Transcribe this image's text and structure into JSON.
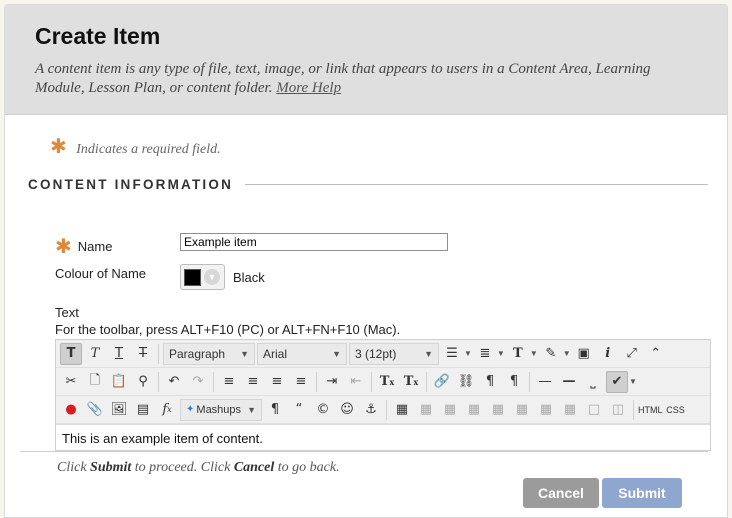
{
  "header": {
    "title": "Create Item",
    "description": "A content item is any type of file, text, image, or link that appears to users in a Content Area, Learning Module, Lesson Plan, or content folder.",
    "help_link": "More Help"
  },
  "required_note": "Indicates a required field.",
  "section": {
    "title": "CONTENT INFORMATION"
  },
  "fields": {
    "name_label": "Name",
    "name_value": "Example item",
    "colour_label": "Colour of Name",
    "colour_value": "Black",
    "colour_hex": "#000000",
    "text_label": "Text",
    "toolbar_hint": "For the toolbar, press ALT+F10 (PC) or ALT+FN+F10 (Mac)."
  },
  "editor": {
    "paragraph_select": "Paragraph",
    "font_select": "Arial",
    "size_select": "3 (12pt)",
    "mashups_label": "Mashups",
    "html_label": "HTML",
    "css_label": "CSS",
    "content": "This is an example item of content."
  },
  "footer": {
    "instruction_prefix": "Click ",
    "submit_word": "Submit",
    "instruction_middle": " to proceed. Click ",
    "cancel_word": "Cancel",
    "instruction_suffix": " to go back.",
    "cancel_button": "Cancel",
    "submit_button": "Submit"
  },
  "colors": {
    "accent_asterisk": "#e0883a",
    "submit_button": "#8fa6cf",
    "cancel_button": "#9b9b9b",
    "header_bg": "#dfdfdf"
  }
}
